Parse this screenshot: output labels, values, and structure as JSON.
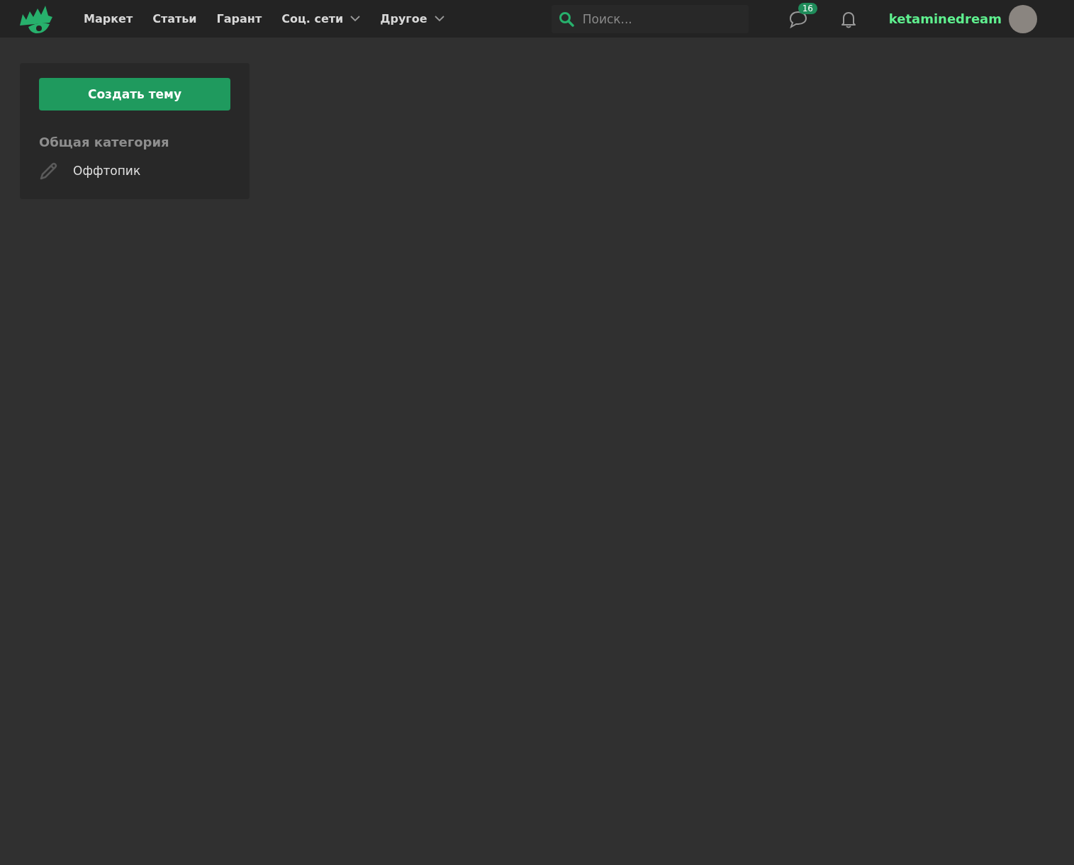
{
  "nav": [
    {
      "label": "Маркет",
      "dropdown": false
    },
    {
      "label": "Статьи",
      "dropdown": false
    },
    {
      "label": "Гарант",
      "dropdown": false
    },
    {
      "label": "Соц. сети",
      "dropdown": true
    },
    {
      "label": "Другое",
      "dropdown": true
    }
  ],
  "search": {
    "placeholder": "Поиск..."
  },
  "messages": {
    "badge": "16"
  },
  "user": {
    "name": "ketaminedream"
  },
  "sidebar": {
    "button": "Создать тему",
    "category": "Общая категория",
    "items": [
      {
        "label": "Оффтопик"
      }
    ]
  }
}
